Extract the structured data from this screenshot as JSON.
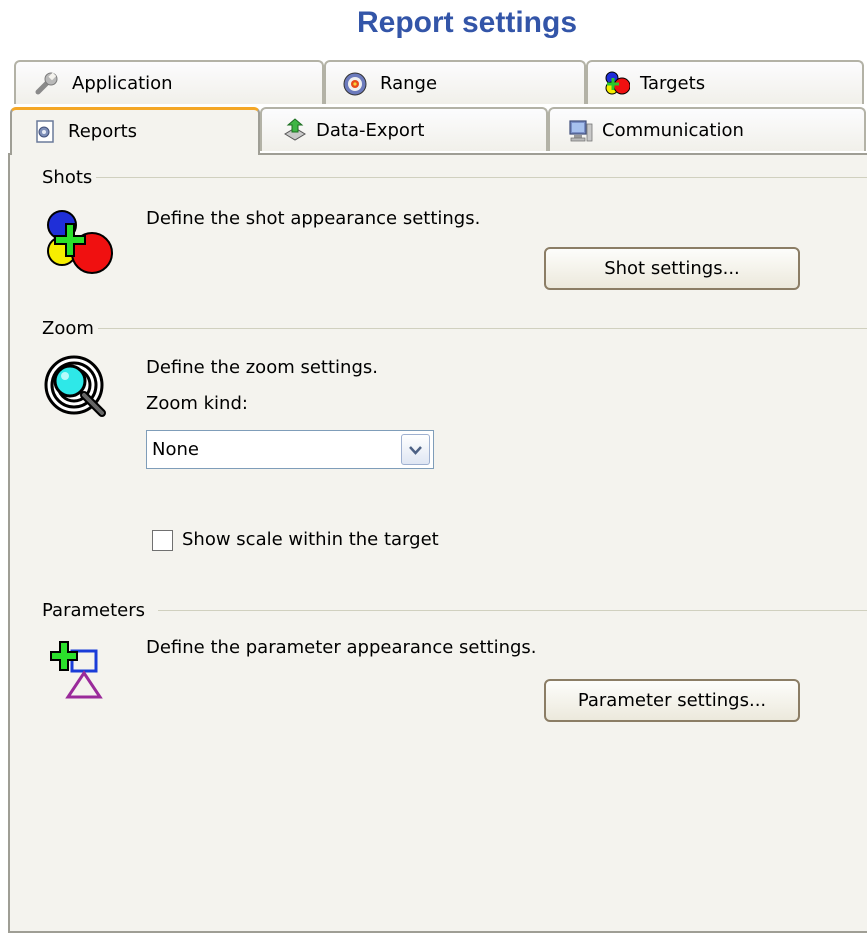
{
  "title": "Report settings",
  "tabs_row1": [
    {
      "label": "Application",
      "icon": "wrench-icon"
    },
    {
      "label": "Range",
      "icon": "target-icon"
    },
    {
      "label": "Targets",
      "icon": "targets-icon"
    }
  ],
  "tabs_row2": [
    {
      "label": "Reports",
      "icon": "report-icon",
      "active": true
    },
    {
      "label": "Data-Export",
      "icon": "data-export-icon"
    },
    {
      "label": "Communication",
      "icon": "computer-icon"
    }
  ],
  "shots": {
    "group_label": "Shots",
    "description": "Define the shot appearance settings.",
    "button_label": "Shot settings..."
  },
  "zoom": {
    "group_label": "Zoom",
    "description": "Define the zoom settings.",
    "kind_label": "Zoom kind:",
    "kind_value": "None",
    "checkbox_label": "Show scale within the target",
    "checkbox_checked": false
  },
  "parameters": {
    "group_label": "Parameters",
    "description": "Define the parameter appearance settings.",
    "button_label": "Parameter settings..."
  },
  "colors": {
    "title": "#3355a8",
    "active_tab_accent": "#f4a726",
    "panel_bg": "#f4f3ee"
  }
}
